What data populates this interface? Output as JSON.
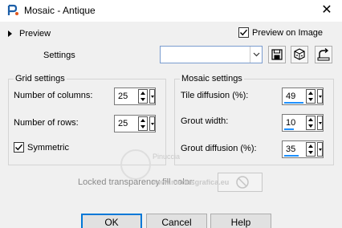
{
  "window": {
    "title": "Mosaic - Antique",
    "close_glyph": "✕"
  },
  "preview": {
    "toggle_label": "Preview",
    "on_image_label": "Preview on Image",
    "on_image_checked": true
  },
  "settings": {
    "label": "Settings",
    "preset_value": ""
  },
  "grid_settings": {
    "title": "Grid settings",
    "columns_label": "Number of columns:",
    "columns_value": "25",
    "rows_label": "Number of rows:",
    "rows_value": "25",
    "symmetric_label": "Symmetric",
    "symmetric_checked": true
  },
  "mosaic_settings": {
    "title": "Mosaic settings",
    "tile_diffusion_label": "Tile diffusion (%):",
    "tile_diffusion_value": "49",
    "grout_width_label": "Grout width:",
    "grout_width_value": "10",
    "grout_diffusion_label": "Grout diffusion (%):",
    "grout_diffusion_value": "35"
  },
  "locked": {
    "label": "Locked transparency fill color:"
  },
  "watermark": {
    "line1": "Pinuccia",
    "line2": "www.madirsgrafica.eu"
  },
  "buttons": {
    "ok": "OK",
    "cancel": "Cancel",
    "help": "Help"
  },
  "colors": {
    "accent": "#0078d7",
    "spin_bar": "#1e90ff",
    "background": "#f0f0f0"
  },
  "icons": [
    "app-icon",
    "close-icon",
    "expand-triangle-icon",
    "save-preset-icon",
    "randomize-icon",
    "reset-icon",
    "spin-up-icon",
    "spin-down-icon",
    "dropdown-arrow-icon"
  ]
}
